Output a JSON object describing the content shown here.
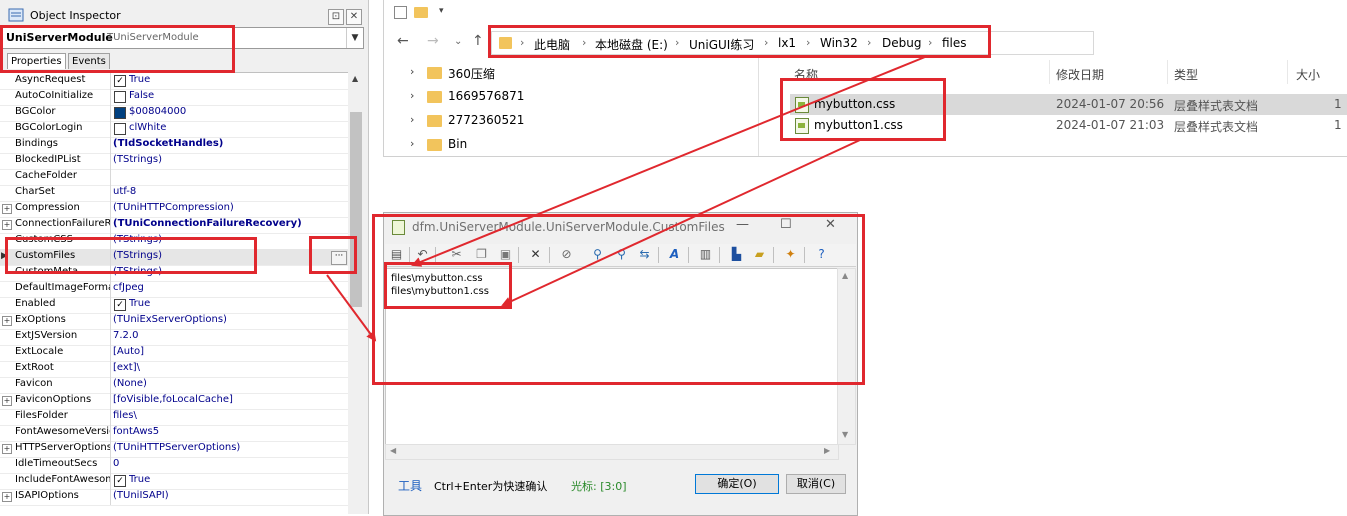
{
  "inspector": {
    "title": "Object Inspector",
    "component_name": "UniServerModule",
    "component_class": "TUniServerModule",
    "tabs": [
      {
        "label": "Properties",
        "active": true
      },
      {
        "label": "Events",
        "active": false
      }
    ],
    "rows": [
      {
        "name": "AsyncRequest",
        "value": "True",
        "kind": "check",
        "checked": true,
        "expand": false,
        "bold": false
      },
      {
        "name": "AutoCoInitialize",
        "value": "False",
        "kind": "check",
        "checked": false,
        "expand": false,
        "bold": false
      },
      {
        "name": "BGColor",
        "value": "$00804000",
        "kind": "color",
        "color": "#004080",
        "expand": false,
        "bold": false
      },
      {
        "name": "BGColorLogin",
        "value": "clWhite",
        "kind": "color",
        "color": "#ffffff",
        "expand": false,
        "bold": false
      },
      {
        "name": "Bindings",
        "value": "(TIdSocketHandles)",
        "kind": "text",
        "expand": false,
        "bold": true
      },
      {
        "name": "BlockedIPList",
        "value": "(TStrings)",
        "kind": "text",
        "expand": false,
        "bold": false
      },
      {
        "name": "CacheFolder",
        "value": "",
        "kind": "text",
        "expand": false,
        "bold": false
      },
      {
        "name": "CharSet",
        "value": "utf-8",
        "kind": "text",
        "expand": false,
        "bold": false
      },
      {
        "name": "Compression",
        "value": "(TUniHTTPCompression)",
        "kind": "text",
        "expand": true,
        "bold": false
      },
      {
        "name": "ConnectionFailureRe",
        "value": "(TUniConnectionFailureRecovery)",
        "kind": "text",
        "expand": true,
        "bold": true
      },
      {
        "name": "CustomCSS",
        "value": "(TStrings)",
        "kind": "text",
        "expand": false,
        "bold": false
      },
      {
        "name": "CustomFiles",
        "value": "(TStrings)",
        "kind": "text",
        "expand": false,
        "bold": false,
        "selected": true
      },
      {
        "name": "CustomMeta",
        "value": "(TStrings)",
        "kind": "text",
        "expand": false,
        "bold": false
      },
      {
        "name": "DefaultImageForma",
        "value": "cfJpeg",
        "kind": "text",
        "expand": false,
        "bold": false
      },
      {
        "name": "Enabled",
        "value": "True",
        "kind": "check",
        "checked": true,
        "expand": false,
        "bold": false
      },
      {
        "name": "ExOptions",
        "value": "(TUniExServerOptions)",
        "kind": "text",
        "expand": true,
        "bold": false
      },
      {
        "name": "ExtJSVersion",
        "value": "7.2.0",
        "kind": "text",
        "expand": false,
        "bold": false
      },
      {
        "name": "ExtLocale",
        "value": "[Auto]",
        "kind": "text",
        "expand": false,
        "bold": false
      },
      {
        "name": "ExtRoot",
        "value": "[ext]\\",
        "kind": "text",
        "expand": false,
        "bold": false
      },
      {
        "name": "Favicon",
        "value": "(None)",
        "kind": "text",
        "expand": false,
        "bold": false
      },
      {
        "name": "FaviconOptions",
        "value": "[foVisible,foLocalCache]",
        "kind": "text",
        "expand": true,
        "bold": false
      },
      {
        "name": "FilesFolder",
        "value": "files\\",
        "kind": "text",
        "expand": false,
        "bold": false
      },
      {
        "name": "FontAwesomeVersio",
        "value": "fontAws5",
        "kind": "text",
        "expand": false,
        "bold": false
      },
      {
        "name": "HTTPServerOptions",
        "value": "(TUniHTTPServerOptions)",
        "kind": "text",
        "expand": true,
        "bold": false
      },
      {
        "name": "IdleTimeoutSecs",
        "value": "0",
        "kind": "text",
        "expand": false,
        "bold": false
      },
      {
        "name": "IncludeFontAwesom",
        "value": "True",
        "kind": "check",
        "checked": true,
        "expand": false,
        "bold": false
      },
      {
        "name": "ISAPIOptions",
        "value": "(TUniISAPI)",
        "kind": "text",
        "expand": true,
        "bold": false
      }
    ]
  },
  "explorer": {
    "breadcrumbs": [
      "此电脑",
      "本地磁盘 (E:)",
      "UniGUI练习",
      "lx1",
      "Win32",
      "Debug",
      "files"
    ],
    "tree": [
      "360压缩",
      "1669576871",
      "2772360521",
      "Bin"
    ],
    "columns": {
      "name": "名称",
      "modified": "修改日期",
      "type": "类型",
      "size": "大小"
    },
    "files": [
      {
        "name": "mybutton.css",
        "modified": "2024-01-07 20:56",
        "type": "层叠样式表文档",
        "size": "1",
        "selected": true
      },
      {
        "name": "mybutton1.css",
        "modified": "2024-01-07 21:03",
        "type": "层叠样式表文档",
        "size": "1",
        "selected": false
      }
    ]
  },
  "dialog": {
    "title": "dfm.UniServerModule.UniServerModule.CustomFiles",
    "lines": [
      "files\\mybutton.css",
      "files\\mybutton1.css"
    ],
    "tools_label": "工具",
    "hint": "Ctrl+Enter为快速确认",
    "cursor_label": "光标: [3:0]",
    "ok_label": "确定(O)",
    "cancel_label": "取消(C)"
  },
  "colors": {
    "annotation": "#e0282e",
    "selection": "#d9d9d9",
    "folder": "#f2c45c",
    "value_text": "#00008b"
  },
  "icons": {
    "tree_chevron": "chevron-right-icon",
    "nav": [
      "back-icon",
      "forward-icon",
      "recent-icon",
      "up-icon"
    ]
  }
}
